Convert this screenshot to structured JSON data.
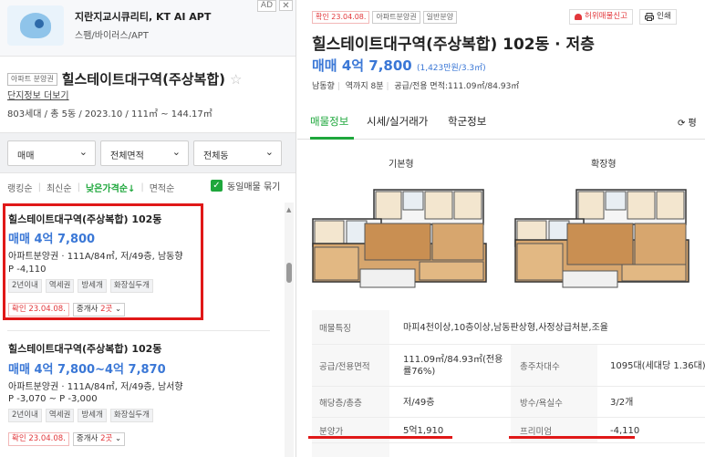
{
  "ad": {
    "title": "지란지교시큐리티, KT AI APT",
    "subtitle": "스팸/바이러스/APT",
    "tag": "AD",
    "close": "✕"
  },
  "complex": {
    "badge": "아파트 분양권",
    "title": "힐스테이트대구역(주상복합)",
    "more_link": "단지정보 더보기",
    "info": "803세대 / 총 5동 / 2023.10 / 111㎡ ~ 144.17㎡"
  },
  "filters": [
    {
      "label": "매매"
    },
    {
      "label": "전체면적"
    },
    {
      "label": "전체동"
    }
  ],
  "sort": {
    "options": [
      "랭킹순",
      "최신순",
      "낮은가격순↓",
      "면적순"
    ],
    "same_check": "동일매물 묶기"
  },
  "listings": [
    {
      "name": "힐스테이트대구역(주상복합) 102동",
      "price": "매매 4억 7,800",
      "desc": "아파트분양권 · 111A/84㎡, 저/49층, 남동향",
      "premium": "P -4,110",
      "tags": [
        "2년이내",
        "역세권",
        "방세개",
        "화장실두개"
      ],
      "confirm": "확인 23.04.08.",
      "broker_prefix": "중개사 ",
      "broker_count": "2곳",
      "broker_chev": "⌄"
    },
    {
      "name": "힐스테이트대구역(주상복합) 102동",
      "price": "매매 4억 7,800~4억 7,870",
      "desc": "아파트분양권 · 111A/84㎡, 저/49층, 남서향",
      "premium": "P -3,070 ~ P -3,000",
      "tags": [
        "2년이내",
        "역세권",
        "방세개",
        "화장실두개"
      ],
      "confirm": "확인 23.04.08.",
      "broker_prefix": "중개사 ",
      "broker_count": "2곳",
      "broker_chev": "⌄"
    }
  ],
  "detail": {
    "badges": [
      "확인 23.04.08.",
      "아파트분양권",
      "일반분양"
    ],
    "report": "허위매물신고",
    "print": "인쇄",
    "title": "힐스테이트대구역(주상복합) 102동 · 저층",
    "price": "매매 4억 7,800",
    "price_per": "(1,423만원/3.3㎡)",
    "meta": [
      "남동향",
      "역까지 8분",
      "공급/전용 면적:111.09㎡/84.93㎡"
    ],
    "tabs": [
      "매물정보",
      "시세/실거래가",
      "학군정보"
    ],
    "refresh": "⟳ 평",
    "plan_basic": "기본형",
    "plan_ext": "확장형",
    "rows": [
      {
        "label": "매물특징",
        "value": "마피4천이상,10층이상,남동판상형,사정상급처분,조율"
      },
      {
        "label": "공급/전용면적",
        "value": "111.09㎡/84.93㎡(전용률76%)",
        "label2": "총주차대수",
        "value2": "1095대(세대당 1.36대)"
      },
      {
        "label": "해당층/총층",
        "value": "저/49층",
        "label2": "방수/욕실수",
        "value2": "3/2개"
      },
      {
        "label": "분양가",
        "value": "5억1,910",
        "label2": "프리미엄",
        "value2": "-4,110"
      }
    ]
  },
  "colors": {
    "accent": "#1ea73c",
    "price": "#3a77d6",
    "highlight": "#e01818"
  }
}
